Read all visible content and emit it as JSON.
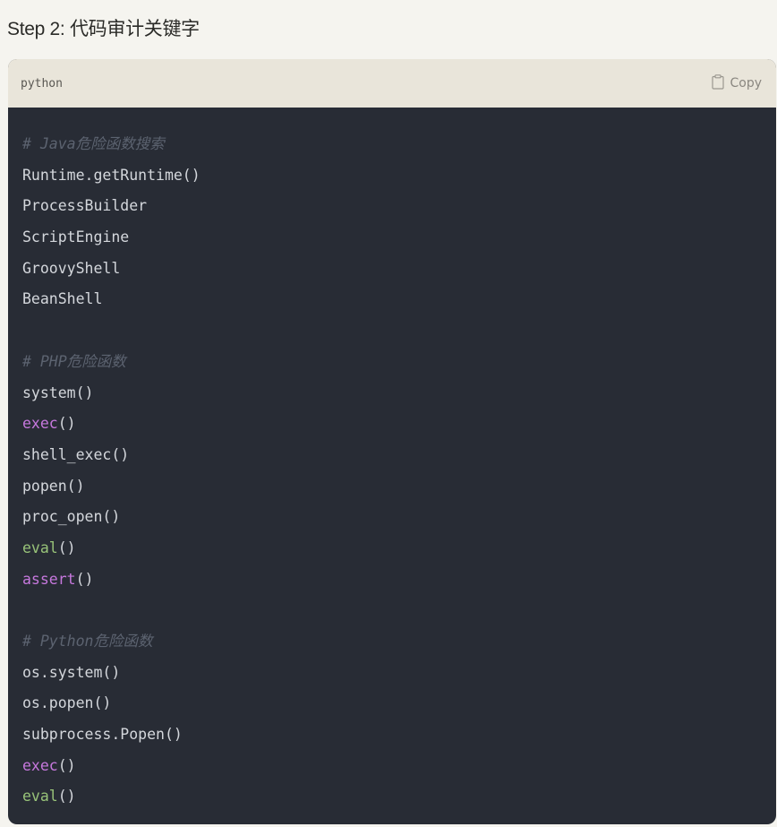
{
  "heading": "Step 2: 代码审计关键字",
  "code_block": {
    "language": "python",
    "copy_label": "Copy",
    "copy_icon": "clipboard-icon",
    "colors": {
      "comment": "#5c6370",
      "plain": "#d4d7dc",
      "keyword": "#c678dd",
      "builtin": "#98c379",
      "background": "#282c35",
      "header_background": "#e9e5da"
    },
    "lines": [
      [
        {
          "t": "comment",
          "v": "# Java危险函数搜索"
        }
      ],
      [
        {
          "t": "plain",
          "v": "Runtime.getRuntime()"
        }
      ],
      [
        {
          "t": "plain",
          "v": "ProcessBuilder"
        }
      ],
      [
        {
          "t": "plain",
          "v": "ScriptEngine"
        }
      ],
      [
        {
          "t": "plain",
          "v": "GroovyShell"
        }
      ],
      [
        {
          "t": "plain",
          "v": "BeanShell"
        }
      ],
      [],
      [
        {
          "t": "comment",
          "v": "# PHP危险函数"
        }
      ],
      [
        {
          "t": "plain",
          "v": "system()"
        }
      ],
      [
        {
          "t": "keyword",
          "v": "exec"
        },
        {
          "t": "plain",
          "v": "()"
        }
      ],
      [
        {
          "t": "plain",
          "v": "shell_exec()"
        }
      ],
      [
        {
          "t": "plain",
          "v": "popen()"
        }
      ],
      [
        {
          "t": "plain",
          "v": "proc_open()"
        }
      ],
      [
        {
          "t": "builtin",
          "v": "eval"
        },
        {
          "t": "plain",
          "v": "()"
        }
      ],
      [
        {
          "t": "keyword",
          "v": "assert"
        },
        {
          "t": "plain",
          "v": "()"
        }
      ],
      [],
      [
        {
          "t": "comment",
          "v": "# Python危险函数"
        }
      ],
      [
        {
          "t": "plain",
          "v": "os.system()"
        }
      ],
      [
        {
          "t": "plain",
          "v": "os.popen()"
        }
      ],
      [
        {
          "t": "plain",
          "v": "subprocess.Popen()"
        }
      ],
      [
        {
          "t": "keyword",
          "v": "exec"
        },
        {
          "t": "plain",
          "v": "()"
        }
      ],
      [
        {
          "t": "builtin",
          "v": "eval"
        },
        {
          "t": "plain",
          "v": "()"
        }
      ]
    ]
  }
}
